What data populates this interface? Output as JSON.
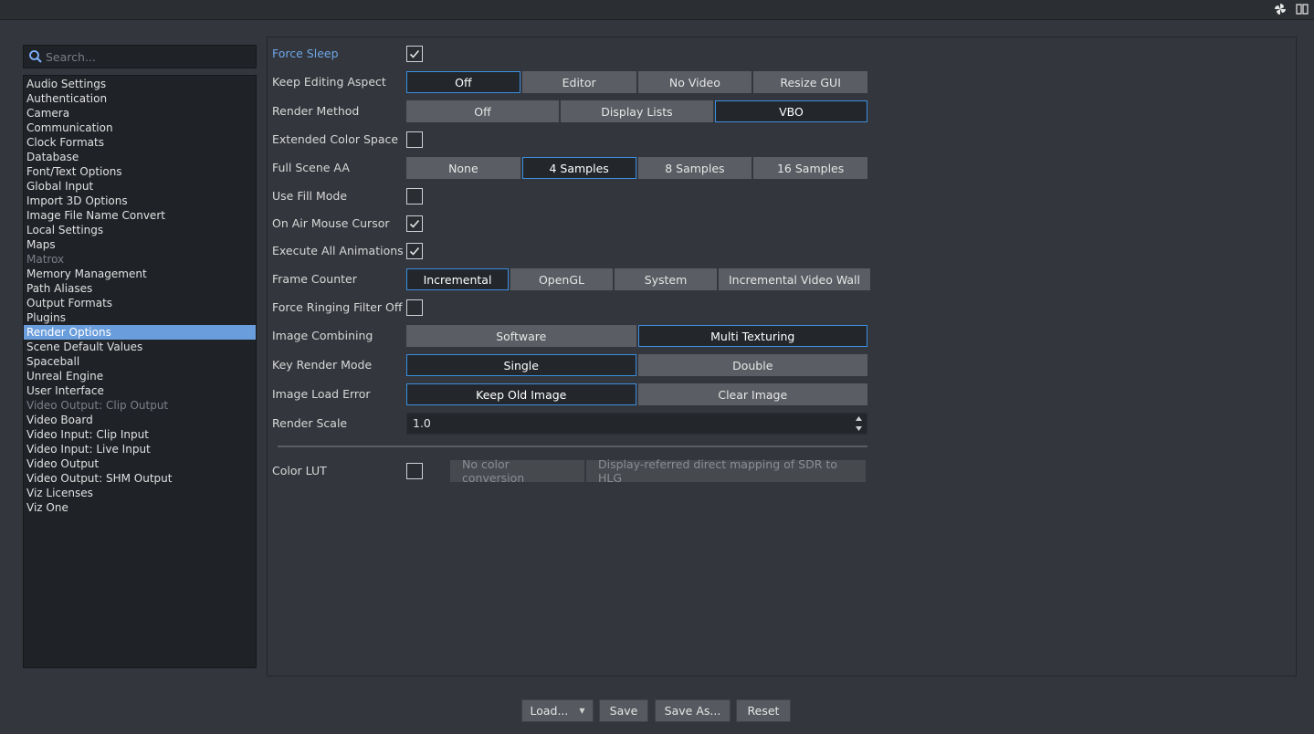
{
  "search": {
    "placeholder": "Search..."
  },
  "sidebar": {
    "items": [
      {
        "label": "Audio Settings",
        "state": "normal"
      },
      {
        "label": "Authentication",
        "state": "normal"
      },
      {
        "label": "Camera",
        "state": "normal"
      },
      {
        "label": "Communication",
        "state": "normal"
      },
      {
        "label": "Clock Formats",
        "state": "normal"
      },
      {
        "label": "Database",
        "state": "normal"
      },
      {
        "label": "Font/Text Options",
        "state": "normal"
      },
      {
        "label": "Global Input",
        "state": "normal"
      },
      {
        "label": "Import 3D Options",
        "state": "normal"
      },
      {
        "label": "Image File Name Convert",
        "state": "normal"
      },
      {
        "label": "Local Settings",
        "state": "normal"
      },
      {
        "label": "Maps",
        "state": "normal"
      },
      {
        "label": "Matrox",
        "state": "disabled"
      },
      {
        "label": "Memory Management",
        "state": "normal"
      },
      {
        "label": "Path Aliases",
        "state": "normal"
      },
      {
        "label": "Output Formats",
        "state": "normal"
      },
      {
        "label": "Plugins",
        "state": "normal"
      },
      {
        "label": "Render Options",
        "state": "selected"
      },
      {
        "label": "Scene Default Values",
        "state": "normal"
      },
      {
        "label": "Spaceball",
        "state": "normal"
      },
      {
        "label": "Unreal Engine",
        "state": "normal"
      },
      {
        "label": "User Interface",
        "state": "normal"
      },
      {
        "label": "Video Output: Clip Output",
        "state": "disabled"
      },
      {
        "label": "Video Board",
        "state": "normal"
      },
      {
        "label": "Video Input: Clip Input",
        "state": "normal"
      },
      {
        "label": "Video Input: Live Input",
        "state": "normal"
      },
      {
        "label": "Video Output",
        "state": "normal"
      },
      {
        "label": "Video Output: SHM Output",
        "state": "normal"
      },
      {
        "label": "Viz Licenses",
        "state": "normal"
      },
      {
        "label": "Viz One",
        "state": "normal"
      }
    ]
  },
  "settings": {
    "force_sleep": {
      "label": "Force Sleep",
      "checked": true
    },
    "keep_editing_aspect": {
      "label": "Keep Editing Aspect",
      "options": [
        "Off",
        "Editor",
        "No Video",
        "Resize GUI"
      ],
      "selected": "Off"
    },
    "render_method": {
      "label": "Render Method",
      "options": [
        "Off",
        "Display Lists",
        "VBO"
      ],
      "selected": "VBO"
    },
    "extended_color_space": {
      "label": "Extended Color Space",
      "checked": false
    },
    "full_scene_aa": {
      "label": "Full Scene AA",
      "options": [
        "None",
        "4 Samples",
        "8 Samples",
        "16 Samples"
      ],
      "selected": "4 Samples"
    },
    "use_fill_mode": {
      "label": "Use Fill Mode",
      "checked": false
    },
    "on_air_mouse_cursor": {
      "label": "On Air Mouse Cursor",
      "checked": true
    },
    "execute_all_animations": {
      "label": "Execute All Animations",
      "checked": true
    },
    "frame_counter": {
      "label": "Frame Counter",
      "options": [
        "Incremental",
        "OpenGL",
        "System",
        "Incremental Video Wall"
      ],
      "selected": "Incremental"
    },
    "force_ringing_filter_off": {
      "label": "Force Ringing Filter Off",
      "checked": false
    },
    "image_combining": {
      "label": "Image Combining",
      "options": [
        "Software",
        "Multi Texturing"
      ],
      "selected": "Multi Texturing"
    },
    "key_render_mode": {
      "label": "Key Render Mode",
      "options": [
        "Single",
        "Double"
      ],
      "selected": "Single"
    },
    "image_load_error": {
      "label": "Image Load Error",
      "options": [
        "Keep Old Image",
        "Clear Image"
      ],
      "selected": "Keep Old Image"
    },
    "render_scale": {
      "label": "Render Scale",
      "value": "1.0"
    },
    "color_lut": {
      "label": "Color LUT",
      "checked": false,
      "options": [
        "No color conversion",
        "Display-referred direct mapping of SDR to HLG"
      ]
    }
  },
  "footer": {
    "load": "Load...",
    "save": "Save",
    "save_as": "Save As...",
    "reset": "Reset"
  },
  "colors": {
    "accent": "#3b8fe0",
    "selected_item": "#6a9ddb",
    "link": "#6ea6e8"
  }
}
